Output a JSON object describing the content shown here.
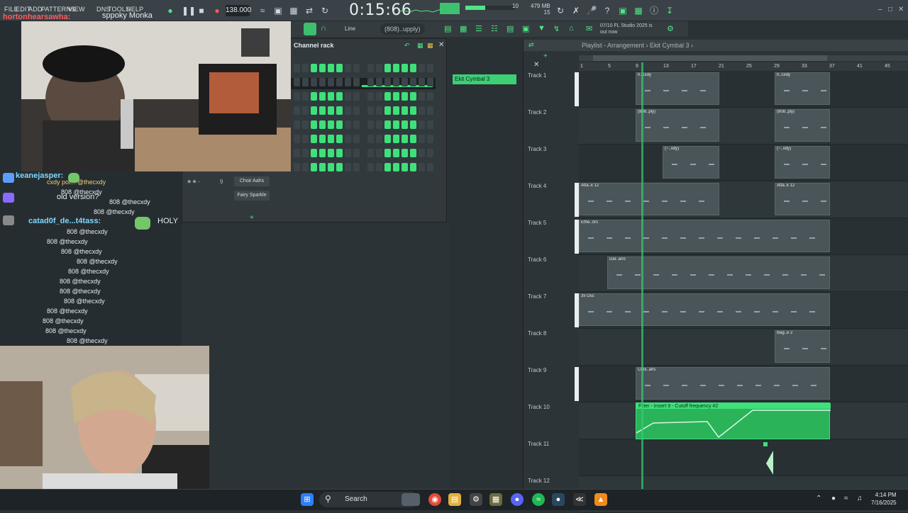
{
  "toolbar": {
    "menu": [
      "FILE",
      "EDIT",
      "ADD",
      "PATTERNS",
      "VIEW",
      "DNS",
      "TOOLS",
      "HELP"
    ],
    "tempo": "138.000",
    "clock": "0:15:66",
    "memory": "479 MB",
    "mem_sub": "15",
    "cpu": "10",
    "snap_label": "Line",
    "pattern": "(808)..upply)",
    "news_line1": "07/10 FL Studio 2025 is",
    "news_line2": "out now"
  },
  "overlay": {
    "top_name": "hortonhearsawha:",
    "top_msg": "sppoky Monka"
  },
  "chat": {
    "lines": [
      {
        "user": "keanejasper:",
        "text": ""
      },
      {
        "user": "",
        "text": "cxdy pol... @thecxdy"
      },
      {
        "user": "",
        "text": "808 @thecxdy"
      },
      {
        "user": "",
        "text": "old version?"
      },
      {
        "user": "",
        "text": "808 @thecxdy"
      },
      {
        "user": "",
        "text": "808 @thecxdy"
      },
      {
        "user": "catad0f_de...t4tass:",
        "text": "HOLY"
      },
      {
        "user": "",
        "text": "808 @thecxdy"
      },
      {
        "user": "",
        "text": "808 @thecxdy"
      },
      {
        "user": "",
        "text": "808 @thecxdy"
      },
      {
        "user": "",
        "text": "808 @thecxdy"
      },
      {
        "user": "",
        "text": "808 @thecxdy"
      },
      {
        "user": "",
        "text": "808 @thecxdy"
      },
      {
        "user": "",
        "text": "808 @thecxdy"
      },
      {
        "user": "",
        "text": "808 @thecxdy"
      },
      {
        "user": "",
        "text": "808 @thecxdy"
      },
      {
        "user": "",
        "text": "808 @thecxdy"
      },
      {
        "user": "",
        "text": "808 @thecxdy"
      },
      {
        "user": "",
        "text": "808 @thecxdy"
      }
    ]
  },
  "rack": {
    "title": "Channel rack",
    "channels": [
      "Choir Aahs",
      "Fairy Sparkle"
    ],
    "channel_num": "9"
  },
  "browser": {
    "pattern_item": "Ekit Cymbal 3"
  },
  "playlist": {
    "breadcrumb": "Playlist - Arrangement › Ekit Cymbal 3 ›",
    "ruler": [
      "1",
      "5",
      "9",
      "13",
      "17",
      "21",
      "25",
      "29",
      "33",
      "37",
      "41",
      "45"
    ],
    "tracks": [
      "Track 1",
      "Track 2",
      "Track 3",
      "Track 4",
      "Track 5",
      "Track 6",
      "Track 7",
      "Track 8",
      "Track 9",
      "Track 10",
      "Track 11",
      "Track 12"
    ],
    "clip_labels": {
      "t1": "h..cxdy",
      "t2": "(808..ply)",
      "t3": "(~..xdy)",
      "t4": "Atta..k 12",
      "t5": "Ethe..ors",
      "t6": "Dar..ano",
      "t7": "3x Osc",
      "t8": "Bag..e 2",
      "t9": "Choi..ahs"
    },
    "automation": "Filter - Insert 9 - Cutoff frequency #2"
  },
  "taskbar": {
    "search": "Search",
    "time": "4:14 PM",
    "date": "7/16/2025"
  }
}
